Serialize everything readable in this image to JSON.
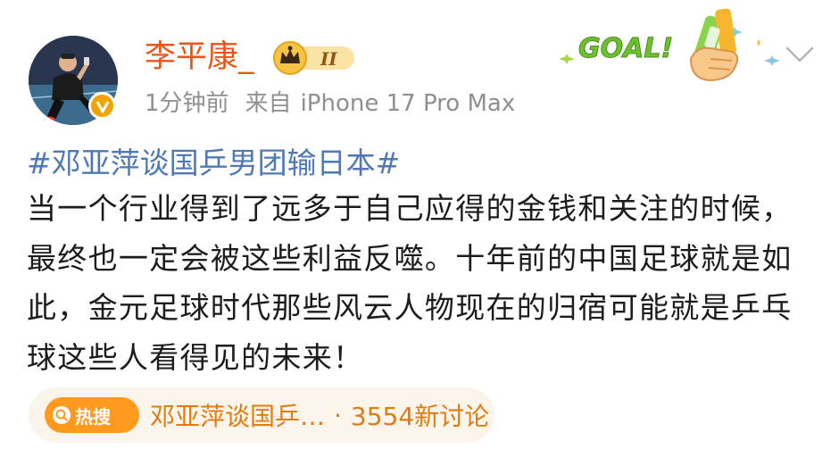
{
  "header": {
    "username": "李平康_",
    "rank_badge_level": "II",
    "time": "1分钟前",
    "source_label": "来自",
    "device": "iPhone 17 Pro Max",
    "goal_text": "GOAL!",
    "verified_mark": "V"
  },
  "post": {
    "hashtag": "#邓亚萍谈国乒男团输日本#",
    "text": "当一个行业得到了远多于自己应得的金钱和关注的时候，最终也一定会被这些利益反噬。十年前的中国足球就是如此，金元足球时代那些风云人物现在的归宿可能就是乒乓球这些人看得见的未来！"
  },
  "trending": {
    "tag": "热搜",
    "title": "邓亚萍谈国乒…",
    "separator": "·",
    "count": "3554新讨论"
  },
  "colors": {
    "username": "#e8561b",
    "meta": "#8f8f8f",
    "hashtag": "#4f79b5",
    "body_text": "#1c1c1c",
    "pill_bg": "#fbf4ea",
    "hot_tag": "#ff9a1f",
    "trend_text": "#e07d12",
    "goal_green": "#6cc12e"
  },
  "icons": {
    "avatar": "user-avatar-photo",
    "verified": "verified-badge-icon",
    "rank": "crown-rank-badge-icon",
    "decoration": "goal-sticker-decoration",
    "dropdown": "chevron-down-icon",
    "search": "search-icon"
  }
}
